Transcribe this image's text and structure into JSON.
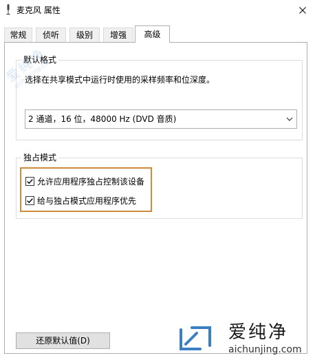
{
  "window": {
    "title": "麦克风 属性",
    "close_icon": "close-icon"
  },
  "tabs": [
    {
      "label": "常规",
      "active": false
    },
    {
      "label": "侦听",
      "active": false
    },
    {
      "label": "级别",
      "active": false
    },
    {
      "label": "增强",
      "active": false
    },
    {
      "label": "高级",
      "active": true
    }
  ],
  "default_format": {
    "group_title": "默认格式",
    "description": "选择在共享模式中运行时使用的采样频率和位深度。",
    "selected_value": "2 通道，16 位，48000 Hz (DVD 音质)",
    "dropdown_icon": "chevron-down-icon"
  },
  "exclusive_mode": {
    "group_title": "独占模式",
    "options": [
      {
        "label": "允许应用程序独占控制该设备",
        "checked": true
      },
      {
        "label": "给与独占模式应用程序优先",
        "checked": true
      }
    ],
    "highlight_color": "#d08a3b"
  },
  "buttons": {
    "restore_defaults": "还原默认值(D)"
  },
  "watermarks": {
    "diagonal_text": "爱纯净",
    "diagonal_url": "aichunjing.com",
    "corner_text": "爱纯净",
    "corner_url": "aichunjing.com",
    "corner_logo_icon": "aichunjing-logo-icon"
  },
  "colors": {
    "accent_highlight": "#d08a3b",
    "tab_inactive_bg": "#f0f0f0",
    "button_bg": "#e1e1e1",
    "border": "#adadad",
    "logo_blue": "#3a7fc4"
  }
}
